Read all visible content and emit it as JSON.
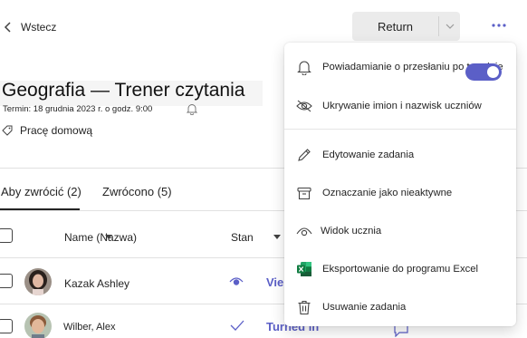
{
  "header": {
    "back_label": "Wstecz",
    "return_button_label": "Return"
  },
  "assignment": {
    "title": "Geografia — Trener czytania",
    "due_text": "Termin: 18 grudnia 2023 r. o godz. 9:00",
    "category_label": "Pracę domową"
  },
  "tabs": [
    {
      "label": "Aby zwrócić (2)",
      "selected": true
    },
    {
      "label": "Zwrócono (5)",
      "selected": false
    }
  ],
  "table": {
    "columns": {
      "name": "Name (Nazwa)",
      "status": "Stan"
    },
    "rows": [
      {
        "name": "Kazak Ashley",
        "status": "Vie"
      },
      {
        "name": "Wilber, Alex",
        "status": "Turned in"
      }
    ]
  },
  "menu": {
    "items": [
      {
        "label": "Powiadamianie o przesłaniu po terminie",
        "icon": "bell-icon",
        "toggle_on": true
      },
      {
        "label": "Ukrywanie imion i nazwisk uczniów",
        "icon": "eye-off-icon"
      },
      {
        "label": "Edytowanie zadania",
        "icon": "pencil-icon"
      },
      {
        "label": "Oznaczanie jako nieaktywne",
        "icon": "archive-icon"
      },
      {
        "label": "Widok ucznia",
        "icon": "eye-icon"
      },
      {
        "label": "Eksportowanie do programu Excel",
        "icon": "excel-icon"
      },
      {
        "label": "Usuwanie zadania",
        "icon": "trash-icon"
      }
    ]
  },
  "colors": {
    "accent": "#5b5fc7",
    "excel_green": "#107c41"
  }
}
